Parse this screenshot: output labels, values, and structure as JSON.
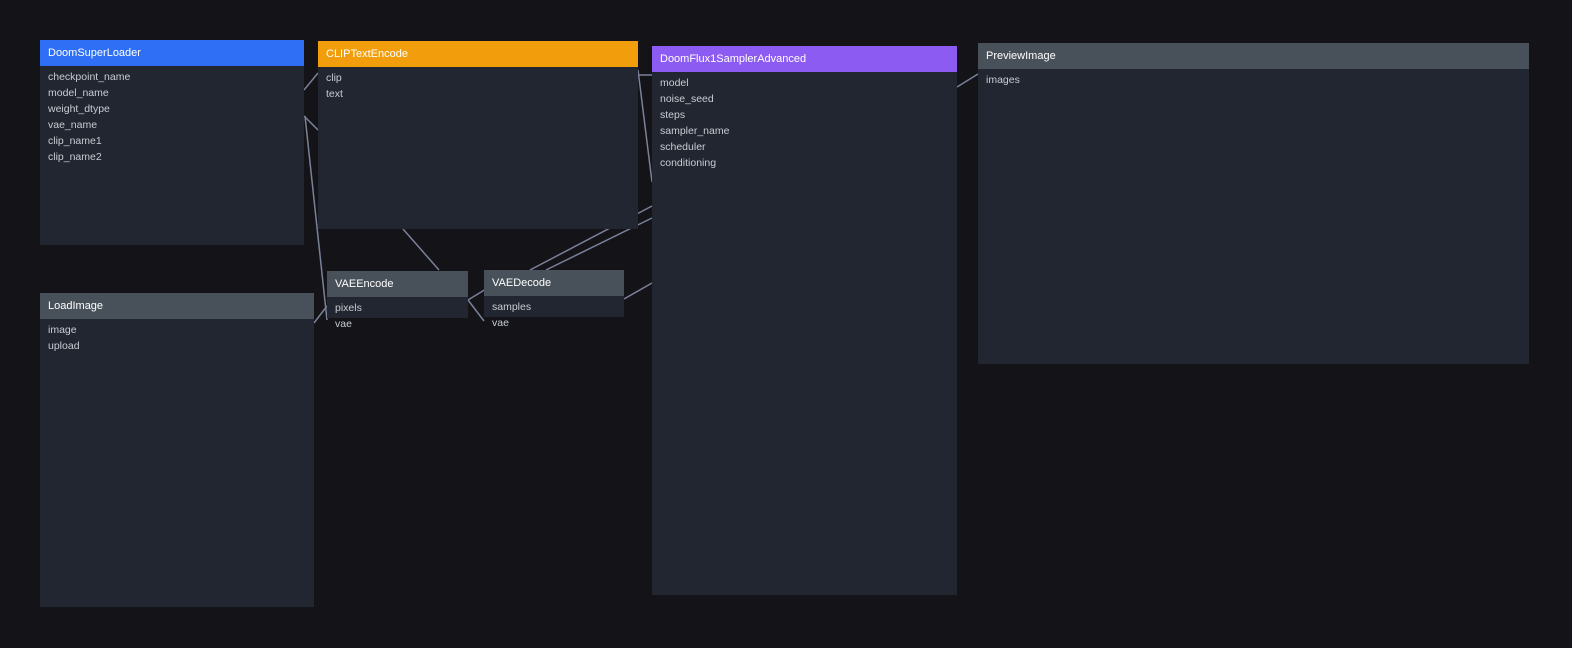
{
  "graph": {
    "nodes": [
      {
        "id": "doom_super_loader",
        "title": "DoomSuperLoader",
        "header_color": "blue",
        "inputs": [
          "checkpoint_name",
          "model_name",
          "weight_dtype",
          "vae_name",
          "clip_name1",
          "clip_name2"
        ]
      },
      {
        "id": "clip_text_encode",
        "title": "CLIPTextEncode",
        "header_color": "orange",
        "inputs": [
          "clip",
          "text"
        ]
      },
      {
        "id": "doom_flux_sampler",
        "title": "DoomFlux1SamplerAdvanced",
        "header_color": "purple",
        "inputs": [
          "model",
          "noise_seed",
          "steps",
          "sampler_name",
          "scheduler",
          "conditioning"
        ]
      },
      {
        "id": "preview_image",
        "title": "PreviewImage",
        "header_color": "gray",
        "inputs": [
          "images"
        ]
      },
      {
        "id": "load_image",
        "title": "LoadImage",
        "header_color": "gray",
        "inputs": [
          "image",
          "upload"
        ]
      },
      {
        "id": "vae_encode",
        "title": "VAEEncode",
        "header_color": "gray",
        "inputs": [
          "pixels",
          "vae"
        ]
      },
      {
        "id": "vae_decode",
        "title": "VAEDecode",
        "header_color": "gray",
        "inputs": [
          "samples",
          "vae"
        ]
      }
    ]
  },
  "colors": {
    "canvas_background": "#131318",
    "node_body": "#222630",
    "header_blue": "#2f6ff5",
    "header_orange": "#f29e0c",
    "header_purple": "#8c5cf2",
    "header_gray": "#485059",
    "link": "#7a8299"
  }
}
